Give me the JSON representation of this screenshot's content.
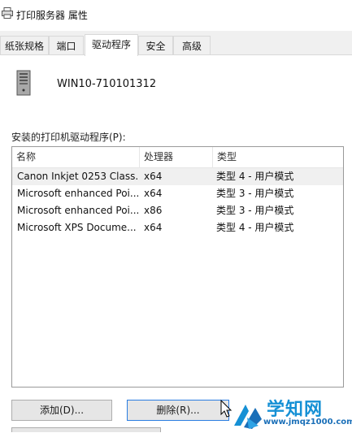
{
  "window": {
    "title": "打印服务器 属性",
    "icon": "printer-icon"
  },
  "tabs": [
    {
      "label": "纸张规格",
      "active": false
    },
    {
      "label": "端口",
      "active": false
    },
    {
      "label": "驱动程序",
      "active": true
    },
    {
      "label": "安全",
      "active": false
    },
    {
      "label": "高级",
      "active": false
    }
  ],
  "server": {
    "name": "WIN10-710101312",
    "icon": "server-icon"
  },
  "drivers": {
    "label": "安装的打印机驱动程序(P):",
    "columns": [
      "名称",
      "处理器",
      "类型"
    ],
    "rows": [
      {
        "name": "Canon Inkjet 0253 Class...",
        "processor": "x64",
        "type": "类型 4 - 用户模式",
        "selected": true
      },
      {
        "name": "Microsoft enhanced Poi...",
        "processor": "x64",
        "type": "类型 3 - 用户模式",
        "selected": false
      },
      {
        "name": "Microsoft enhanced Poi...",
        "processor": "x86",
        "type": "类型 3 - 用户模式",
        "selected": false
      },
      {
        "name": "Microsoft XPS Docume...",
        "processor": "x64",
        "type": "类型 4 - 用户模式",
        "selected": false
      }
    ]
  },
  "buttons": {
    "add": "添加(D)...",
    "delete": "删除(R)..."
  },
  "watermark": {
    "title": "学知网",
    "url": "www.jmqz1000.com"
  },
  "colors": {
    "focus": "#2a7de1",
    "watermark": "#1590d5"
  }
}
